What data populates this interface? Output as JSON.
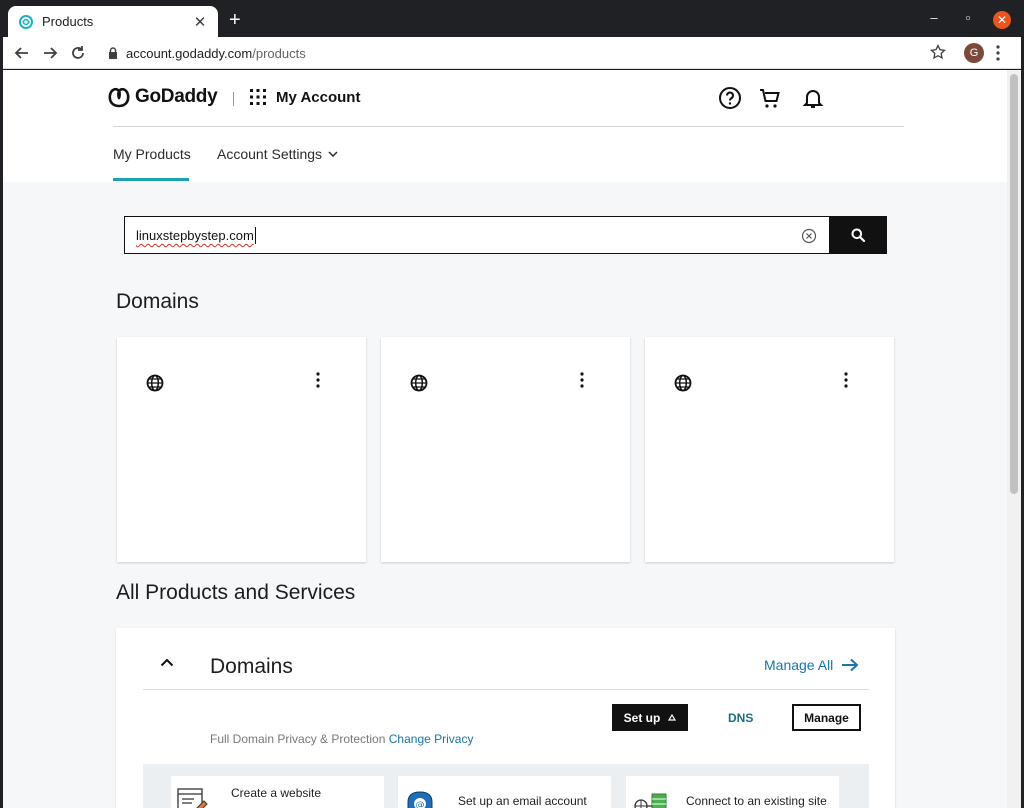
{
  "browser": {
    "tab_title": "Products",
    "new_tab_label": "+",
    "url_host": "account.godaddy.com",
    "url_path": "/products",
    "profile_initial": "G"
  },
  "header": {
    "logo_text": "GoDaddy",
    "account_label": "My Account"
  },
  "nav": {
    "my_products": "My Products",
    "account_settings": "Account Settings"
  },
  "search": {
    "value": "linuxstepbystep.com"
  },
  "sections": {
    "domains_title": "Domains",
    "all_products_title": "All Products and Services"
  },
  "domain_cards": [
    {
      "icon": "globe-icon"
    },
    {
      "icon": "globe-icon"
    },
    {
      "icon": "globe-icon"
    }
  ],
  "products_group": {
    "title": "Domains",
    "manage_all": "Manage All",
    "setup_label": "Set up",
    "dns_label": "DNS",
    "manage_label": "Manage",
    "privacy_text": "Full Domain Privacy & Protection",
    "privacy_link": "Change Privacy",
    "actions": [
      {
        "label": "Create a website"
      },
      {
        "label": "Set up an email account"
      },
      {
        "label": "Connect to an existing site"
      }
    ]
  },
  "colors": {
    "accent_teal": "#17a3b0",
    "link_blue": "#1976a8",
    "window_close": "#e95420"
  }
}
